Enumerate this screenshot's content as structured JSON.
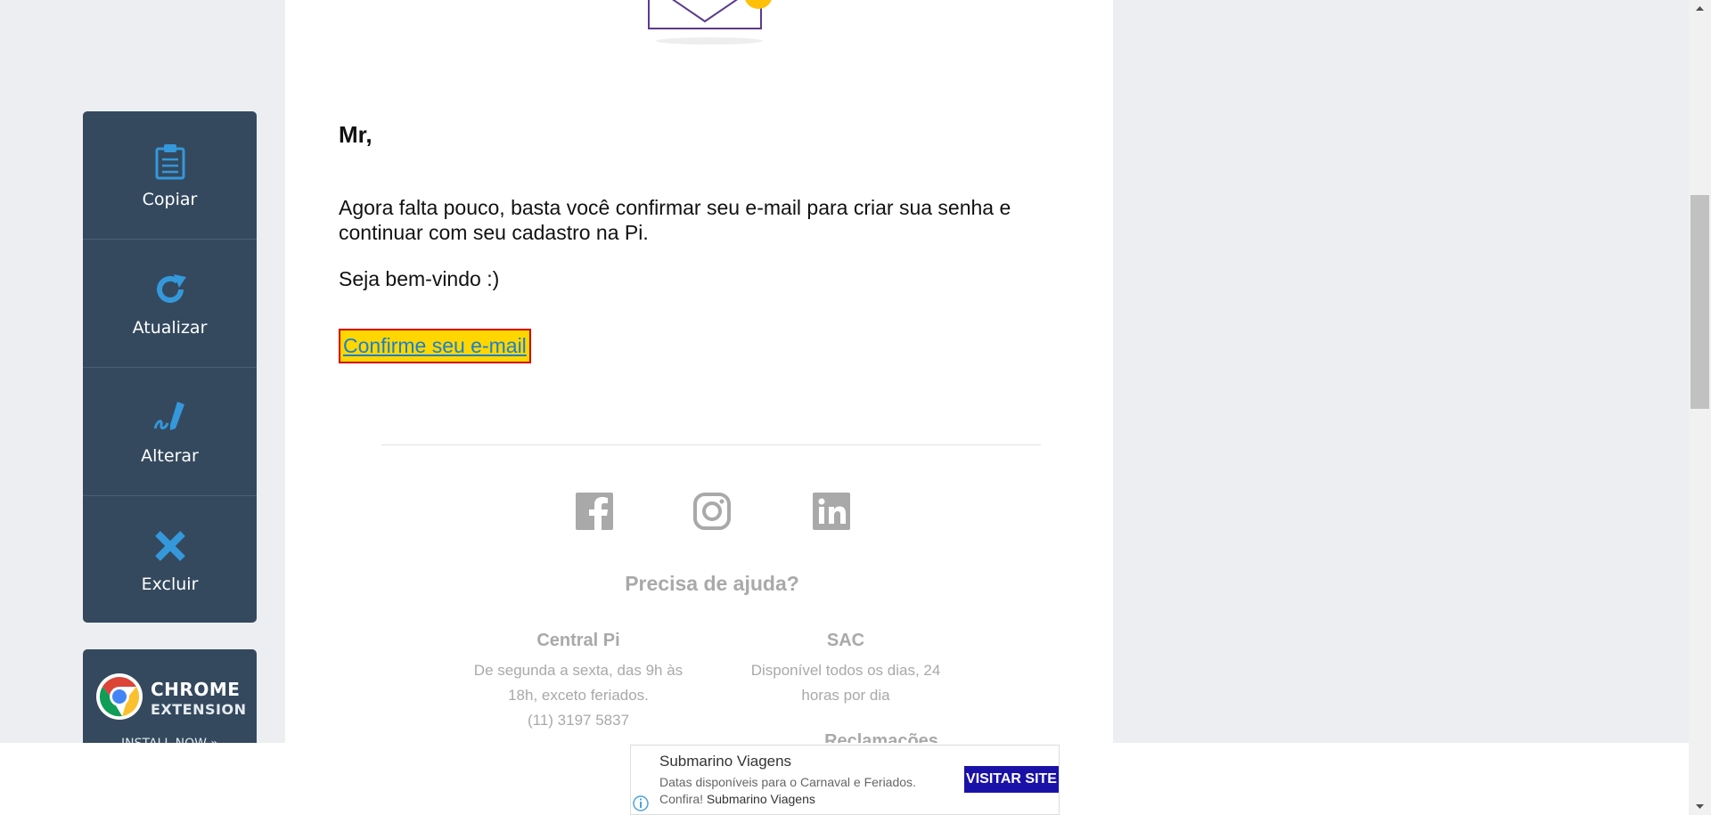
{
  "sidebar": {
    "items": [
      {
        "label": "Copiar",
        "icon": "clipboard-icon"
      },
      {
        "label": "Atualizar",
        "icon": "refresh-icon"
      },
      {
        "label": "Alterar",
        "icon": "edit-icon"
      },
      {
        "label": "Excluir",
        "icon": "close-icon"
      }
    ],
    "chrome_extension": {
      "title": "CHROME",
      "subtitle": "EXTENSION",
      "install": "INSTALL NOW »"
    }
  },
  "email": {
    "greeting": "Mr,",
    "paragraph": "Agora falta pouco, basta você confirmar seu e-mail para criar sua senha e continuar com seu cadastro na Pi.",
    "welcome": "Seja bem-vindo :)",
    "confirm_link": "Confirme seu e-mail",
    "social": [
      "facebook-icon",
      "instagram-icon",
      "linkedin-icon"
    ],
    "help_title": "Precisa de ajuda?",
    "central": {
      "title": "Central Pi",
      "text": "De segunda a sexta, das 9h às 18h, exceto feriados.",
      "phone": "(11) 3197 5837"
    },
    "sac": {
      "title": "SAC",
      "text": "Disponível todos os dias, 24 horas por dia"
    },
    "reclamacoes": "Reclamações"
  },
  "ad": {
    "title": "Submarino Viagens",
    "line1": "Datas disponíveis para o Carnaval e Feriados.",
    "line2_prefix": "Confira!",
    "line2_brand": "Submarino Viagens",
    "button": "VISITAR SITE"
  },
  "colors": {
    "sidebar": "#34495e",
    "accent": "#3498db",
    "highlight": "#ffd600",
    "link": "#1a7fd0"
  }
}
